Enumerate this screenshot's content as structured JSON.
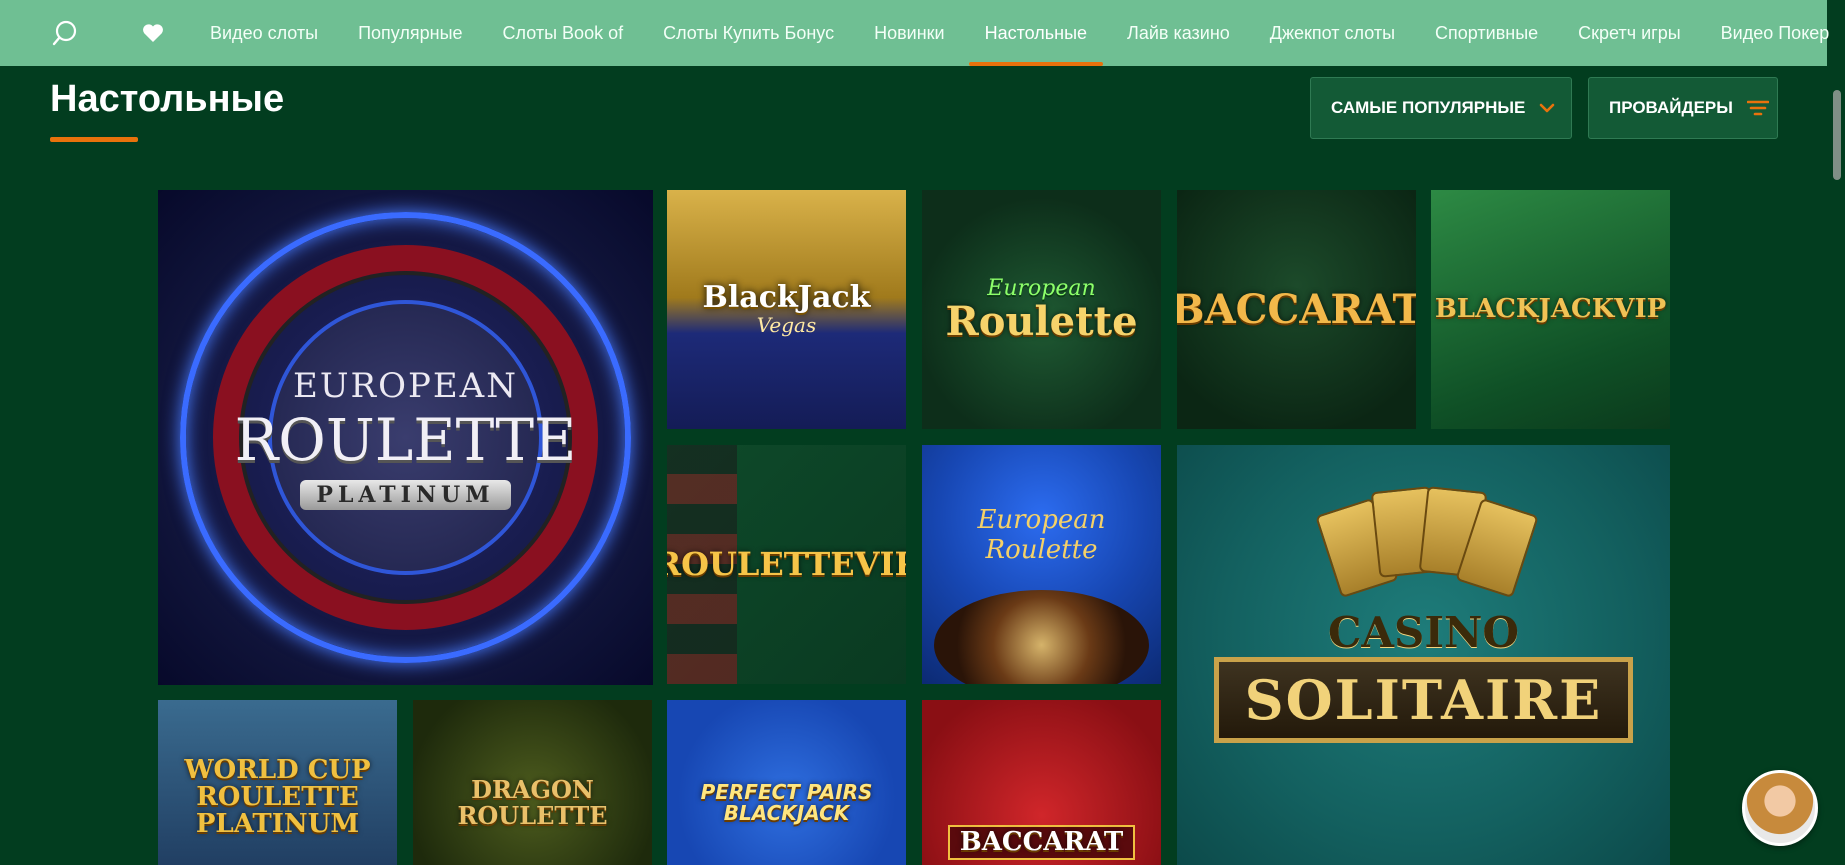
{
  "nav": {
    "search_icon": "search-icon",
    "favorites_icon": "heart-icon",
    "items": [
      {
        "label": "Видео слоты"
      },
      {
        "label": "Популярные"
      },
      {
        "label": "Слоты Book of"
      },
      {
        "label": "Слоты Купить Бонус"
      },
      {
        "label": "Новинки"
      },
      {
        "label": "Настольные",
        "active": true
      },
      {
        "label": "Лайв казино"
      },
      {
        "label": "Джекпот слоты"
      },
      {
        "label": "Спортивные"
      },
      {
        "label": "Скретч игры"
      },
      {
        "label": "Видео Покер"
      }
    ]
  },
  "page": {
    "title": "Настольные",
    "sort_button": "САМЫЕ ПОПУЛЯРНЫЕ",
    "providers_button": "ПРОВАЙДЕРЫ"
  },
  "games": [
    {
      "l1": "EUROPEAN",
      "l2": "ROULETTE",
      "l3": "PLATINUM"
    },
    {
      "title": "BlackJack",
      "sub": "Vegas"
    },
    {
      "sub": "European",
      "title": "Roulette"
    },
    {
      "title": "BACCARAT"
    },
    {
      "title": "BLACKJACKVIP"
    },
    {
      "title": "ROULETTEVIP"
    },
    {
      "sub": "European Roulette"
    },
    {
      "l1": "CASINO",
      "l2": "SOLITAIRE"
    },
    {
      "title": "WORLD CUP ROULETTE PLATINUM"
    },
    {
      "title": "DRAGON ROULETTE"
    },
    {
      "title": "PERFECT PAIRS BLACKJACK"
    },
    {
      "title": "BACCARAT"
    }
  ],
  "colors": {
    "nav_bg": "#6fbf93",
    "page_bg": "#023d1f",
    "accent": "#e8720c"
  }
}
